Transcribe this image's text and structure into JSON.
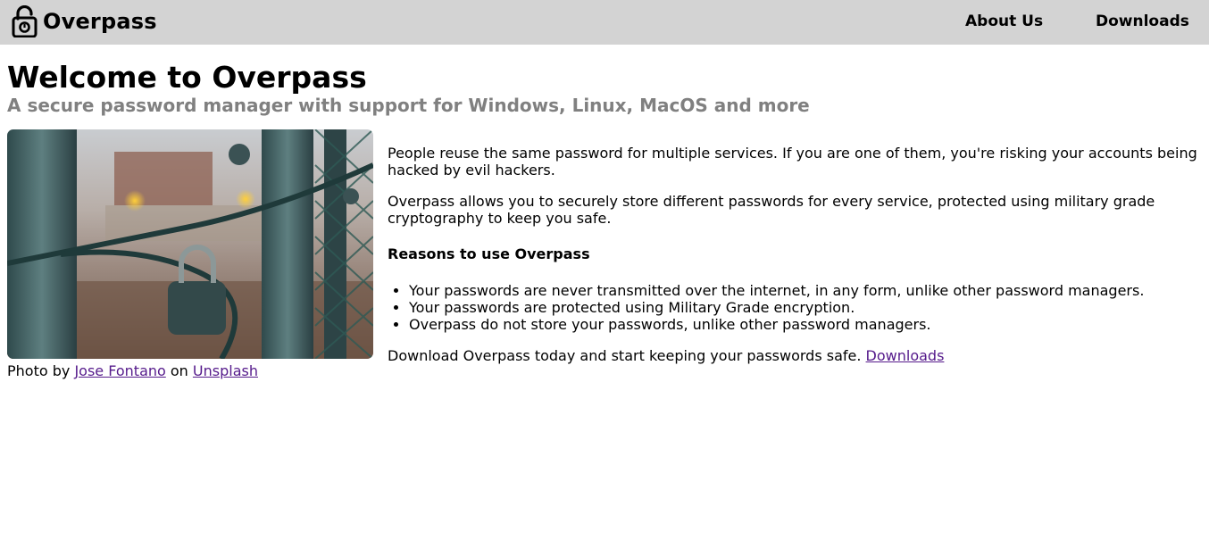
{
  "navbar": {
    "brand_name": "Overpass",
    "brand_icon": "padlock-icon",
    "links": [
      {
        "label": "About Us"
      },
      {
        "label": "Downloads"
      }
    ]
  },
  "hero": {
    "title": "Welcome to Overpass",
    "subtitle": "A secure password manager with support for Windows, Linux, MacOS and more"
  },
  "photo": {
    "alt": "Chained gate with padlock",
    "caption_prefix": "Photo by",
    "author": "Jose Fontano",
    "caption_mid": "on",
    "source": "Unsplash"
  },
  "content": {
    "para1": "People reuse the same password for multiple services. If you are one of them, you're risking your accounts being hacked by evil hackers.",
    "para2": "Overpass allows you to securely store different passwords for every service, protected using military grade cryptography to keep you safe.",
    "reasons_heading": "Reasons to use Overpass",
    "reasons": [
      "Your passwords are never transmitted over the internet, in any form, unlike other password managers.",
      "Your passwords are protected using Military Grade encryption.",
      "Overpass do not store your passwords, unlike other password managers."
    ],
    "cta_text": "Download Overpass today and start keeping your passwords safe.",
    "cta_link": "Downloads"
  },
  "colors": {
    "navbar_bg": "#d3d3d3",
    "subtitle": "#808080",
    "link": "#551a8b"
  }
}
